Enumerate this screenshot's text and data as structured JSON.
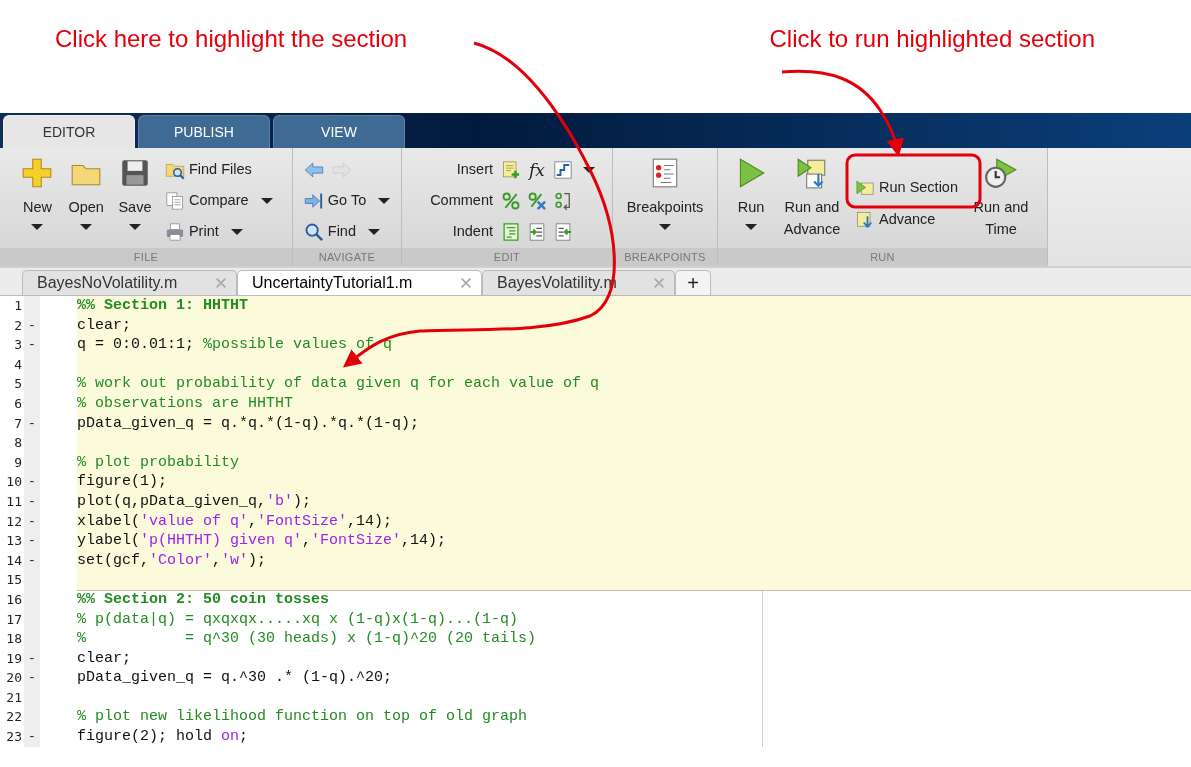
{
  "annotations": [
    {
      "text": "Click here to highlight the section"
    },
    {
      "text": "Click to run highlighted section"
    }
  ],
  "toolstrip_tabs": [
    {
      "label": "EDITOR",
      "selected": true
    },
    {
      "label": "PUBLISH",
      "selected": false
    },
    {
      "label": "VIEW",
      "selected": false
    }
  ],
  "groups": [
    {
      "label": "FILE",
      "items": [
        {
          "kind": "large",
          "label": "New",
          "dropdown": true
        },
        {
          "kind": "large",
          "label": "Open",
          "dropdown": true
        },
        {
          "kind": "large",
          "label": "Save",
          "dropdown": true
        },
        {
          "kind": "stack",
          "items": [
            {
              "kind": "button",
              "label": "Find Files",
              "dropdown": false
            },
            {
              "kind": "button",
              "label": "Compare",
              "dropdown": true
            },
            {
              "kind": "button",
              "label": "Print",
              "dropdown": true
            }
          ]
        }
      ]
    },
    {
      "label": "NAVIGATE",
      "items": [
        {
          "kind": "stack",
          "items": [
            {
              "kind": "history",
              "back_disabled": false,
              "forward_disabled": true
            },
            {
              "kind": "button",
              "label": "Go To",
              "dropdown": true
            },
            {
              "kind": "button",
              "label": "Find",
              "dropdown": true
            }
          ]
        }
      ]
    },
    {
      "label": "EDIT",
      "items": [
        {
          "kind": "rows",
          "rows": [
            {
              "label": "Insert",
              "symbol": "fx",
              "dropdown": true
            },
            {
              "label": "Comment",
              "dropdown": false
            },
            {
              "label": "Indent",
              "dropdown": false
            }
          ]
        }
      ]
    },
    {
      "label": "BREAKPOINTS",
      "items": [
        {
          "kind": "large",
          "label": "Breakpoints",
          "dropdown": true
        }
      ]
    },
    {
      "label": "RUN",
      "items": [
        {
          "kind": "large",
          "label": "Run",
          "dropdown": true
        },
        {
          "kind": "large",
          "label": "Run and Advance",
          "dropdown": false
        },
        {
          "kind": "stack",
          "items": [
            {
              "kind": "button",
              "label": "Run Section",
              "dropdown": false
            },
            {
              "kind": "button",
              "label": "Advance",
              "dropdown": false
            }
          ]
        },
        {
          "kind": "large",
          "label": "Run and Time",
          "dropdown": false
        }
      ]
    }
  ],
  "document_tabs": [
    {
      "label": "BayesNoVolatility.m",
      "selected": false
    },
    {
      "label": "UncertaintyTutorial1.m",
      "selected": true
    },
    {
      "label": "BayesVolatility.m",
      "selected": false
    }
  ],
  "new_tab_button": "+",
  "sections": [
    {
      "selected": true,
      "lines": [
        {
          "number": "1",
          "tokens": [
            {
              "kind": "section",
              "text": "%% Section 1: HHTHT"
            }
          ]
        },
        {
          "number": "2",
          "marker": "-",
          "tokens": [
            {
              "kind": "code",
              "text": "clear;"
            }
          ]
        },
        {
          "number": "3",
          "marker": "-",
          "tokens": [
            {
              "kind": "code",
              "text": "q = 0:0.01:1; "
            },
            {
              "kind": "comment",
              "text": "%possible values of q"
            }
          ]
        },
        {
          "number": "4"
        },
        {
          "number": "5",
          "tokens": [
            {
              "kind": "comment",
              "text": "% work out probability of data given q for each value of q"
            }
          ]
        },
        {
          "number": "6",
          "tokens": [
            {
              "kind": "comment",
              "text": "% observations are HHTHT"
            }
          ]
        },
        {
          "number": "7",
          "marker": "-",
          "tokens": [
            {
              "kind": "code",
              "text": "pData_given_q = q.*q.*(1-q).*q.*(1-q);"
            }
          ]
        },
        {
          "number": "8"
        },
        {
          "number": "9",
          "tokens": [
            {
              "kind": "comment",
              "text": "% plot probability"
            }
          ]
        },
        {
          "number": "10",
          "marker": "-",
          "tokens": [
            {
              "kind": "code",
              "text": "figure(1);"
            }
          ]
        },
        {
          "number": "11",
          "marker": "-",
          "tokens": [
            {
              "kind": "code",
              "text": "plot(q,pData_given_q,"
            },
            {
              "kind": "string",
              "text": "'b'"
            },
            {
              "kind": "code",
              "text": ");"
            }
          ]
        },
        {
          "number": "12",
          "marker": "-",
          "tokens": [
            {
              "kind": "code",
              "text": "xlabel("
            },
            {
              "kind": "string",
              "text": "'value of q'"
            },
            {
              "kind": "code",
              "text": ","
            },
            {
              "kind": "string",
              "text": "'FontSize'"
            },
            {
              "kind": "code",
              "text": ",14);"
            }
          ]
        },
        {
          "number": "13",
          "marker": "-",
          "tokens": [
            {
              "kind": "code",
              "text": "ylabel("
            },
            {
              "kind": "string",
              "text": "'p(HHTHT) given q'"
            },
            {
              "kind": "code",
              "text": ","
            },
            {
              "kind": "string",
              "text": "'FontSize'"
            },
            {
              "kind": "code",
              "text": ",14);"
            }
          ]
        },
        {
          "number": "14",
          "marker": "-",
          "tokens": [
            {
              "kind": "code",
              "text": "set(gcf,"
            },
            {
              "kind": "string",
              "text": "'Color'"
            },
            {
              "kind": "code",
              "text": ","
            },
            {
              "kind": "string",
              "text": "'w'"
            },
            {
              "kind": "code",
              "text": ");"
            }
          ]
        },
        {
          "number": "15"
        }
      ]
    },
    {
      "selected": false,
      "lines": [
        {
          "number": "16",
          "tokens": [
            {
              "kind": "section",
              "text": "%% Section 2: 50 coin tosses"
            }
          ]
        },
        {
          "number": "17",
          "tokens": [
            {
              "kind": "comment",
              "text": "% p(data|q) = qxqxqx.....xq x (1-q)x(1-q)...(1-q)"
            }
          ]
        },
        {
          "number": "18",
          "tokens": [
            {
              "kind": "comment",
              "text": "%           = q^30 (30 heads) x (1-q)^20 (20 tails)"
            }
          ]
        },
        {
          "number": "19",
          "marker": "-",
          "tokens": [
            {
              "kind": "code",
              "text": "clear;"
            }
          ]
        },
        {
          "number": "20",
          "marker": "-",
          "tokens": [
            {
              "kind": "code",
              "text": "pData_given_q = q.^30 .* (1-q).^20;"
            }
          ]
        },
        {
          "number": "21"
        },
        {
          "number": "22",
          "tokens": [
            {
              "kind": "comment",
              "text": "% plot new likelihood function on top of old graph"
            }
          ]
        },
        {
          "number": "23",
          "marker": "-",
          "tokens": [
            {
              "kind": "code",
              "text": "figure(2); hold "
            },
            {
              "kind": "string",
              "text": "on"
            },
            {
              "kind": "code",
              "text": ";"
            }
          ]
        }
      ]
    }
  ]
}
